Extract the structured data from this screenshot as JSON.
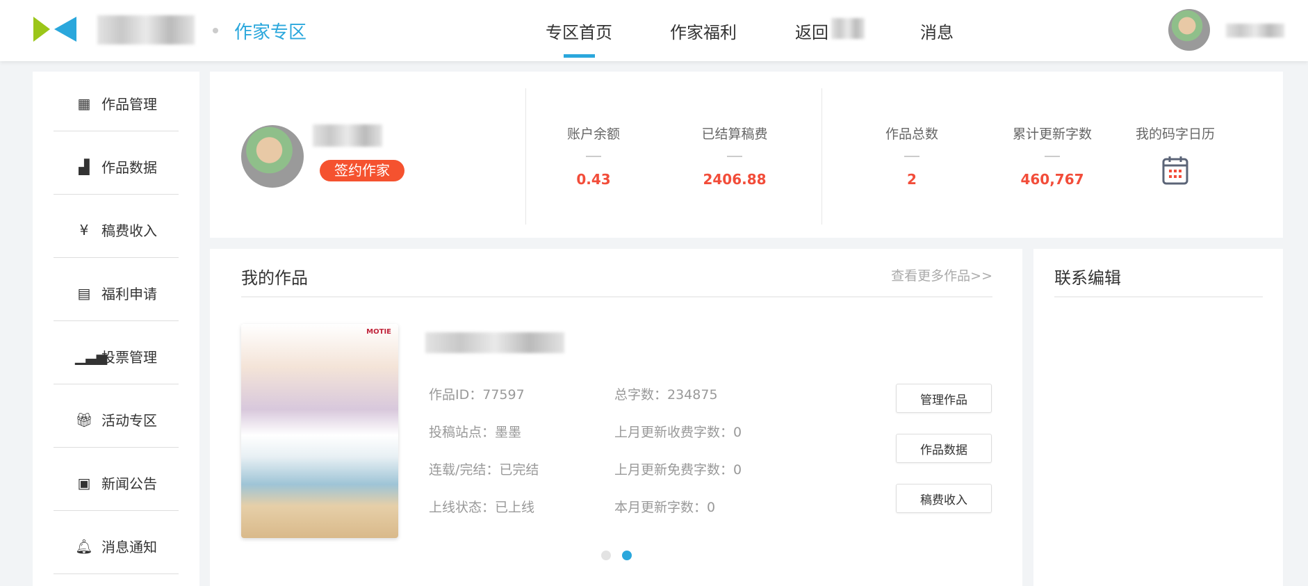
{
  "header": {
    "zone_title": "作家专区",
    "nav": [
      "专区首页",
      "作家福利",
      "返回",
      "消息"
    ],
    "active_nav": 0
  },
  "sidebar": {
    "items": [
      {
        "label": "作品管理",
        "icon": "grid-icon"
      },
      {
        "label": "作品数据",
        "icon": "bar-chart-icon"
      },
      {
        "label": "稿费收入",
        "icon": "yen-icon"
      },
      {
        "label": "福利申请",
        "icon": "document-icon"
      },
      {
        "label": "投票管理",
        "icon": "signal-icon"
      },
      {
        "label": "活动专区",
        "icon": "gift-icon"
      },
      {
        "label": "新闻公告",
        "icon": "newspaper-icon"
      },
      {
        "label": "消息通知",
        "icon": "bell-icon"
      }
    ]
  },
  "profile": {
    "badge": "签约作家"
  },
  "stats": [
    {
      "label": "账户余额",
      "value": "0.43"
    },
    {
      "label": "已结算稿费",
      "value": "2406.88"
    },
    {
      "label": "作品总数",
      "value": "2"
    },
    {
      "label": "累计更新字数",
      "value": "460,767"
    },
    {
      "label": "我的码字日历",
      "icon": "calendar-icon"
    }
  ],
  "works": {
    "title": "我的作品",
    "more": "查看更多作品>>",
    "cover_text": "MOTIE",
    "info_left": [
      "作品ID：77597",
      "投稿站点：墨墨",
      "连载/完结：已完结",
      "上线状态：已上线"
    ],
    "info_right": [
      "总字数：234875",
      "上月更新收费字数：0",
      "上月更新免费字数：0",
      "本月更新字数：0"
    ],
    "buttons": [
      "管理作品",
      "作品数据",
      "稿费收入"
    ],
    "carousel_pages": 2,
    "carousel_active": 2
  },
  "contact": {
    "title": "联系编辑"
  },
  "colors": {
    "accent": "#2aa7dc",
    "highlight": "#f24d3a"
  }
}
